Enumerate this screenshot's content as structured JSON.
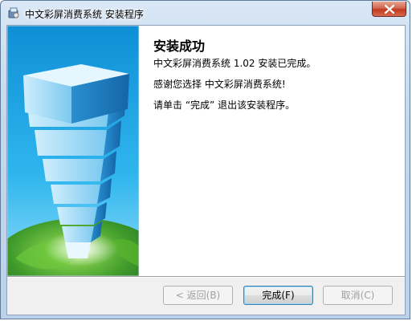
{
  "window": {
    "title": "中文彩屏消费系统 安装程序"
  },
  "content": {
    "heading": "安装成功",
    "line1": "中文彩屏消费系统 1.02 安装已完成。",
    "line2": "感谢您选择 中文彩屏消费系统!",
    "line3": "请单击 “完成” 退出该安装程序。"
  },
  "buttons": {
    "back": "< 返回(B)",
    "finish": "完成(F)",
    "cancel": "取消(C)"
  },
  "icons": {
    "app": "installer-icon",
    "close": "close-icon",
    "side_image": "globe-building-illustration"
  },
  "colors": {
    "title_bar": "#c3d7ec",
    "close_button": "#c2391f",
    "dialog_background": "#f0f0f0",
    "banner_background": "#ffffff",
    "image_sky": "#1aa8e6"
  }
}
